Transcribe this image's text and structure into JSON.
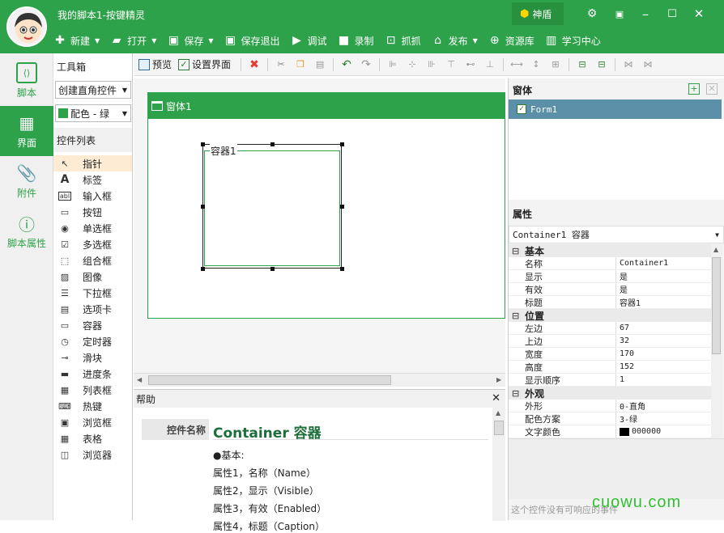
{
  "app": {
    "title": "我的脚本1-按键精灵",
    "shield_label": "神盾"
  },
  "main_toolbar": [
    {
      "icon": "plus-icon",
      "label": "新建",
      "dd": true
    },
    {
      "icon": "folder-open-icon",
      "label": "打开",
      "dd": true
    },
    {
      "icon": "save-icon",
      "label": "保存",
      "dd": true
    },
    {
      "icon": "save-exit-icon",
      "label": "保存退出",
      "dd": false
    },
    {
      "icon": "debug-play-icon",
      "label": "调试",
      "dd": false
    },
    {
      "icon": "record-camera-icon",
      "label": "录制",
      "dd": false
    },
    {
      "icon": "grab-icon",
      "label": "抓抓",
      "dd": false
    },
    {
      "icon": "publish-icon",
      "label": "发布",
      "dd": true
    },
    {
      "icon": "resource-library-icon",
      "label": "资源库",
      "dd": false
    },
    {
      "icon": "learning-center-icon",
      "label": "学习中心",
      "dd": false
    }
  ],
  "rail": [
    {
      "label": "脚本",
      "icon": "script-icon",
      "active": false
    },
    {
      "label": "界面",
      "icon": "interface-icon",
      "active": true
    },
    {
      "label": "附件",
      "icon": "attachment-icon",
      "active": false
    },
    {
      "label": "脚本属性",
      "icon": "info-icon",
      "active": false
    }
  ],
  "toolbox": {
    "title": "工具箱",
    "create_combo": "创建直角控件",
    "color_combo": "配色 - 绿",
    "list_title": "控件列表",
    "items": [
      {
        "icon": "pointer-icon",
        "glyph": "↖",
        "label": "指针"
      },
      {
        "icon": "label-icon",
        "glyph": "A",
        "label": "标签"
      },
      {
        "icon": "input-box-icon",
        "glyph": "abl",
        "label": "输入框"
      },
      {
        "icon": "button-icon",
        "glyph": "▭",
        "label": "按钮"
      },
      {
        "icon": "radio-icon",
        "glyph": "◉",
        "label": "单选框"
      },
      {
        "icon": "checkbox-icon",
        "glyph": "☑",
        "label": "多选框"
      },
      {
        "icon": "group-box-icon",
        "glyph": "⬚",
        "label": "组合框"
      },
      {
        "icon": "image-icon",
        "glyph": "▨",
        "label": "图像"
      },
      {
        "icon": "dropdown-icon",
        "glyph": "☰",
        "label": "下拉框"
      },
      {
        "icon": "tab-icon",
        "glyph": "▤",
        "label": "选项卡"
      },
      {
        "icon": "container-icon",
        "glyph": "▭",
        "label": "容器"
      },
      {
        "icon": "timer-icon",
        "glyph": "◷",
        "label": "定时器"
      },
      {
        "icon": "slider-icon",
        "glyph": "⊸",
        "label": "滑块"
      },
      {
        "icon": "progress-bar-icon",
        "glyph": "▬",
        "label": "进度条"
      },
      {
        "icon": "list-box-icon",
        "glyph": "▦",
        "label": "列表框"
      },
      {
        "icon": "hotkey-icon",
        "glyph": "⌨",
        "label": "热键"
      },
      {
        "icon": "browse-box-icon",
        "glyph": "▣",
        "label": "浏览框"
      },
      {
        "icon": "table-icon",
        "glyph": "▦",
        "label": "表格"
      },
      {
        "icon": "browser-icon",
        "glyph": "◫",
        "label": "浏览器"
      }
    ]
  },
  "designer_toolbar": {
    "preview": "预览",
    "settings": "设置界面"
  },
  "form": {
    "title": "窗体1",
    "container_label": "容器1"
  },
  "help": {
    "title": "帮助",
    "key": "控件名称",
    "heading": "Container 容器",
    "lines": [
      "●基本:",
      "属性1，名称（Name）",
      "属性2，显示（Visible）",
      "属性3，有效（Enabled）",
      "属性4，标题（Caption）"
    ]
  },
  "right": {
    "forms_title": "窗体",
    "form_item": "Form1",
    "props_title": "属性",
    "selected": "Container1 容器",
    "groups": [
      {
        "name": "基本",
        "rows": [
          [
            "名称",
            "Container1"
          ],
          [
            "显示",
            "是"
          ],
          [
            "有效",
            "是"
          ],
          [
            "标题",
            "容器1"
          ]
        ]
      },
      {
        "name": "位置",
        "rows": [
          [
            "左边",
            "67"
          ],
          [
            "上边",
            "32"
          ],
          [
            "宽度",
            "170"
          ],
          [
            "高度",
            "152"
          ],
          [
            "显示顺序",
            "1"
          ]
        ]
      },
      {
        "name": "外观",
        "rows": [
          [
            "外形",
            "0-直角"
          ],
          [
            "配色方案",
            "3-绿"
          ],
          [
            "文字颜色",
            "000000"
          ]
        ]
      }
    ],
    "text_color_swatch": "#000000",
    "description": "这个控件没有可响应的事件"
  },
  "watermark": "cuowu.com",
  "colors": {
    "brand": "#2ea24a",
    "selection": "#5c8fa8"
  }
}
